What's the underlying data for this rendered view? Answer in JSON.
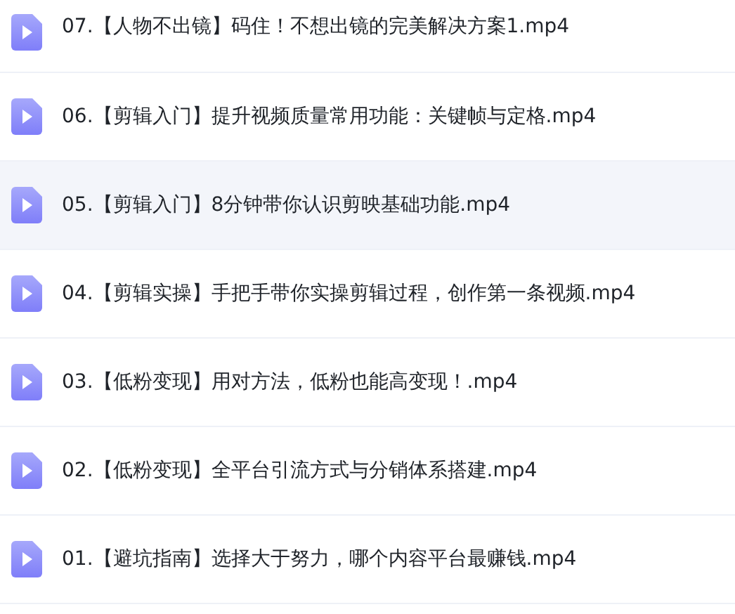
{
  "files": [
    {
      "name": "07.【人物不出镜】码住！不想出镜的完美解决方案1.mp4",
      "selected": false
    },
    {
      "name": "06.【剪辑入门】提升视频质量常用功能：关键帧与定格.mp4",
      "selected": false
    },
    {
      "name": "05.【剪辑入门】8分钟带你认识剪映基础功能.mp4",
      "selected": true
    },
    {
      "name": "04.【剪辑实操】手把手带你实操剪辑过程，创作第一条视频.mp4",
      "selected": false
    },
    {
      "name": "03.【低粉变现】用对方法，低粉也能高变现！.mp4",
      "selected": false
    },
    {
      "name": "02.【低粉变现】全平台引流方式与分销体系搭建.mp4",
      "selected": false
    },
    {
      "name": "01.【避坑指南】选择大于努力，哪个内容平台最赚钱.mp4",
      "selected": false
    }
  ]
}
